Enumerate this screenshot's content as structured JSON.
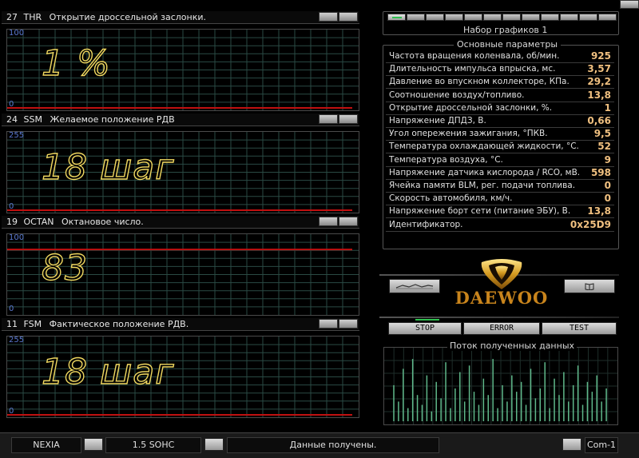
{
  "charts": [
    {
      "num": "27",
      "code": "THR",
      "title": "Открытие дроссельной заслонки.",
      "max": "100",
      "min": "0",
      "value": "1 %",
      "line_level": 0.0
    },
    {
      "num": "24",
      "code": "SSM",
      "title": "Желаемое положение РДВ",
      "max": "255",
      "min": "0",
      "value": "18 шаг",
      "line_level": 0.0
    },
    {
      "num": "19",
      "code": "OCTAN",
      "title": "Октановое число.",
      "max": "100",
      "min": "0",
      "value": "83",
      "line_level": 0.83
    },
    {
      "num": "11",
      "code": "FSM",
      "title": "Фактическое положение РДВ.",
      "max": "255",
      "min": "0",
      "value": "18 шаг",
      "line_level": 0.0
    }
  ],
  "graph_set_title": "Набор графиков 1",
  "params_title": "Основные параметры",
  "params": [
    {
      "label": "Частота вращения коленвала, об/мин.",
      "value": "925"
    },
    {
      "label": "Длительность импульса впрыска, мс.",
      "value": "3,57"
    },
    {
      "label": "Давление во впускном коллекторе, КПа.",
      "value": "29,2"
    },
    {
      "label": "Соотношение воздух/топливо.",
      "value": "13,8"
    },
    {
      "label": "Открытие дроссельной заслонки, %.",
      "value": "1"
    },
    {
      "label": "Напряжение ДПДЗ, В.",
      "value": "0,66"
    },
    {
      "label": "Угол опережения зажигания, °ПКВ.",
      "value": "9,5"
    },
    {
      "label": "Температура охлаждающей жидкости, °С.",
      "value": "52"
    },
    {
      "label": "Температура воздуха, °С.",
      "value": "9"
    },
    {
      "label": "Напряжение датчика кислорода / RCO, мВ.",
      "value": "598"
    },
    {
      "label": "Ячейка памяти BLM, рег. подачи топлива.",
      "value": "0"
    },
    {
      "label": "Скорость автомобиля, км/ч.",
      "value": "0"
    },
    {
      "label": "Напряжение борт сети (питание ЭБУ), В.",
      "value": "13,8"
    },
    {
      "label": "Идентификатор.",
      "value": "0x25D9"
    }
  ],
  "logo_text": "DAEWOO",
  "buttons": {
    "stop": "STOP",
    "error": "ERROR",
    "test": "TEST"
  },
  "stream_title": "Поток полученных данных",
  "stream_bars": [
    0.55,
    0.3,
    0.8,
    0.2,
    0.95,
    0.4,
    0.25,
    0.7,
    0.15,
    0.6,
    0.35,
    0.9,
    0.2,
    0.5,
    0.75,
    0.3,
    0.85,
    0.45,
    0.25,
    0.65,
    0.4,
    0.95,
    0.2,
    0.55,
    0.3,
    0.7,
    0.45,
    0.6,
    0.25,
    0.8,
    0.35,
    0.5,
    0.9,
    0.2,
    0.65,
    0.4,
    0.75,
    0.3,
    0.55,
    0.85,
    0.25,
    0.6,
    0.45,
    0.7,
    0.3,
    0.5
  ],
  "status": {
    "model": "NEXIA",
    "engine": "1.5 SOHC",
    "message": "Данные получены.",
    "port": "Com-1"
  },
  "colors": {
    "grid": "#2a4a44",
    "trace": "#c01010",
    "value_stroke": "#f0d860",
    "stream": "#5fb88a",
    "axis_label": "#5a78d0"
  }
}
